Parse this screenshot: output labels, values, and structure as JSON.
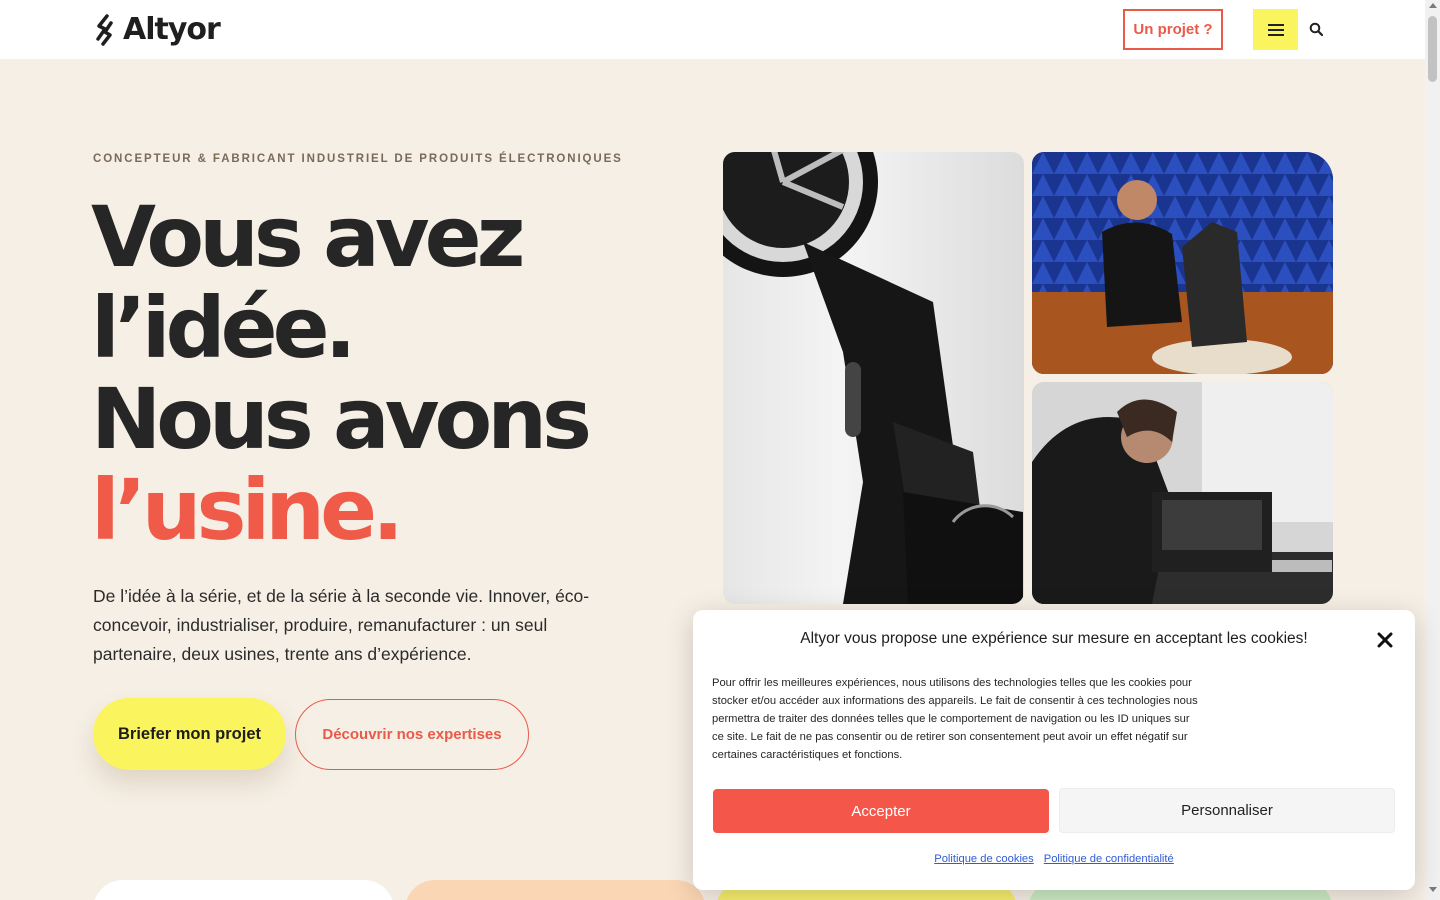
{
  "header": {
    "logo_text": "Altyor",
    "project_button": "Un projet ?",
    "menu_icon": "hamburger-icon",
    "search_icon": "search-icon"
  },
  "hero": {
    "eyebrow": "CONCEPTEUR & FABRICANT INDUSTRIEL DE PRODUITS ÉLECTRONIQUES",
    "headline_line1": "Vous avez",
    "headline_line2": "l’idée.",
    "headline_line3": "Nous avons",
    "headline_line4": "l’usine.",
    "lead": "De l’idée à la série, et de la série à la seconde vie. Innover, éco-concevoir, industrialiser, produire, remanufacturer : un seul partenaire, deux usines, trente ans d’expérience.",
    "cta_primary": "Briefer mon projet",
    "cta_secondary": "Découvrir nos expertises"
  },
  "colors": {
    "accent_red": "#f05a49",
    "accent_yellow": "#faf55e",
    "background": "#f6efe5"
  },
  "cookie_banner": {
    "title": "Altyor vous propose une expérience sur mesure en acceptant les cookies!",
    "body": "Pour offrir les meilleures expériences, nous utilisons des technologies telles que les cookies pour stocker et/ou accéder aux informations des appareils. Le fait de consentir à ces technologies nous permettra de traiter des données telles que le comportement de navigation ou les ID uniques sur ce site. Le fait de ne pas consentir ou de retirer son consentement peut avoir un effet négatif sur certaines caractéristiques et fonctions.",
    "accept_button": "Accepter",
    "customize_button": "Personnaliser",
    "cookie_policy_link": "Politique de cookies",
    "privacy_policy_link": "Politique de confidentialité",
    "close_icon": "close-icon"
  }
}
